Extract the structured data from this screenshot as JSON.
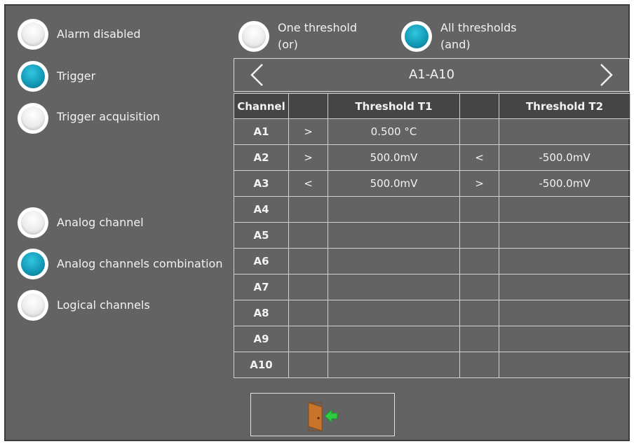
{
  "modes": {
    "alarm_disabled": {
      "label": "Alarm disabled",
      "selected": false
    },
    "trigger": {
      "label": "Trigger",
      "selected": true
    },
    "trigger_acquisition": {
      "label": "Trigger acquisition",
      "selected": false
    }
  },
  "sources": {
    "analog_channel": {
      "label": "Analog channel",
      "selected": false
    },
    "analog_combination": {
      "label": "Analog channels combination",
      "selected": true
    },
    "logical_channels": {
      "label": "Logical channels",
      "selected": false
    }
  },
  "logic": {
    "one_threshold": {
      "line1": "One threshold",
      "line2": "(or)",
      "selected": false
    },
    "all_thresholds": {
      "line1": "All thresholds",
      "line2": "(and)",
      "selected": true
    }
  },
  "nav": {
    "prev_icon": "chevron-left-icon",
    "title": "A1-A10",
    "next_icon": "chevron-right-icon"
  },
  "table": {
    "headers": {
      "channel": "Channel",
      "t1": "Threshold T1",
      "t2": "Threshold T2"
    },
    "rows": [
      {
        "channel": "A1",
        "op1": ">",
        "t1": "0.500 °C",
        "op2": "",
        "t2": ""
      },
      {
        "channel": "A2",
        "op1": ">",
        "t1": "500.0mV",
        "op2": "<",
        "t2": "-500.0mV"
      },
      {
        "channel": "A3",
        "op1": "<",
        "t1": "500.0mV",
        "op2": ">",
        "t2": "-500.0mV"
      },
      {
        "channel": "A4",
        "op1": "",
        "t1": "",
        "op2": "",
        "t2": ""
      },
      {
        "channel": "A5",
        "op1": "",
        "t1": "",
        "op2": "",
        "t2": ""
      },
      {
        "channel": "A6",
        "op1": "",
        "t1": "",
        "op2": "",
        "t2": ""
      },
      {
        "channel": "A7",
        "op1": "",
        "t1": "",
        "op2": "",
        "t2": ""
      },
      {
        "channel": "A8",
        "op1": "",
        "t1": "",
        "op2": "",
        "t2": ""
      },
      {
        "channel": "A9",
        "op1": "",
        "t1": "",
        "op2": "",
        "t2": ""
      },
      {
        "channel": "A10",
        "op1": "",
        "t1": "",
        "op2": "",
        "t2": ""
      }
    ]
  },
  "exit_button": {
    "icon": "exit-door-icon"
  },
  "colors": {
    "panel": "#636363",
    "radio_on": "#139bb8",
    "header_bg": "#454545",
    "exit_arrow": "#2ecc40",
    "door": "#c8742a"
  }
}
